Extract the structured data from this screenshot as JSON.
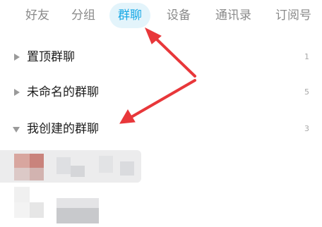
{
  "tabs": [
    {
      "label": "好友",
      "active": false
    },
    {
      "label": "分组",
      "active": false
    },
    {
      "label": "群聊",
      "active": true
    },
    {
      "label": "设备",
      "active": false
    },
    {
      "label": "通讯录",
      "active": false
    },
    {
      "label": "订阅号",
      "active": false
    }
  ],
  "groups": [
    {
      "name": "置顶群聊",
      "count": "1",
      "expanded": false
    },
    {
      "name": "未命名的群聊",
      "count": "5",
      "expanded": false
    },
    {
      "name": "我创建的群聊",
      "count": "3",
      "expanded": true
    }
  ],
  "colors": {
    "accent": "#19a9e6",
    "active_tab_bg": "#e3f4fb",
    "annotation_arrow": "#e8373a"
  },
  "icons": {
    "collapsed": "triangle-right-icon",
    "expanded": "triangle-down-icon"
  }
}
